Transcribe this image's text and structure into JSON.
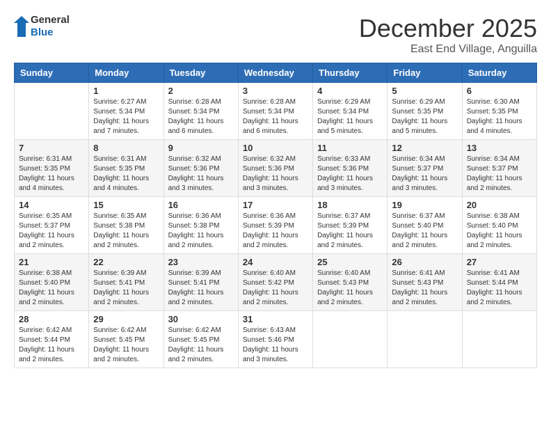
{
  "header": {
    "logo_general": "General",
    "logo_blue": "Blue",
    "month": "December 2025",
    "location": "East End Village, Anguilla"
  },
  "days_of_week": [
    "Sunday",
    "Monday",
    "Tuesday",
    "Wednesday",
    "Thursday",
    "Friday",
    "Saturday"
  ],
  "weeks": [
    [
      {
        "day": "",
        "info": ""
      },
      {
        "day": "1",
        "info": "Sunrise: 6:27 AM\nSunset: 5:34 PM\nDaylight: 11 hours\nand 7 minutes."
      },
      {
        "day": "2",
        "info": "Sunrise: 6:28 AM\nSunset: 5:34 PM\nDaylight: 11 hours\nand 6 minutes."
      },
      {
        "day": "3",
        "info": "Sunrise: 6:28 AM\nSunset: 5:34 PM\nDaylight: 11 hours\nand 6 minutes."
      },
      {
        "day": "4",
        "info": "Sunrise: 6:29 AM\nSunset: 5:34 PM\nDaylight: 11 hours\nand 5 minutes."
      },
      {
        "day": "5",
        "info": "Sunrise: 6:29 AM\nSunset: 5:35 PM\nDaylight: 11 hours\nand 5 minutes."
      },
      {
        "day": "6",
        "info": "Sunrise: 6:30 AM\nSunset: 5:35 PM\nDaylight: 11 hours\nand 4 minutes."
      }
    ],
    [
      {
        "day": "7",
        "info": "Sunrise: 6:31 AM\nSunset: 5:35 PM\nDaylight: 11 hours\nand 4 minutes."
      },
      {
        "day": "8",
        "info": "Sunrise: 6:31 AM\nSunset: 5:35 PM\nDaylight: 11 hours\nand 4 minutes."
      },
      {
        "day": "9",
        "info": "Sunrise: 6:32 AM\nSunset: 5:36 PM\nDaylight: 11 hours\nand 3 minutes."
      },
      {
        "day": "10",
        "info": "Sunrise: 6:32 AM\nSunset: 5:36 PM\nDaylight: 11 hours\nand 3 minutes."
      },
      {
        "day": "11",
        "info": "Sunrise: 6:33 AM\nSunset: 5:36 PM\nDaylight: 11 hours\nand 3 minutes."
      },
      {
        "day": "12",
        "info": "Sunrise: 6:34 AM\nSunset: 5:37 PM\nDaylight: 11 hours\nand 3 minutes."
      },
      {
        "day": "13",
        "info": "Sunrise: 6:34 AM\nSunset: 5:37 PM\nDaylight: 11 hours\nand 2 minutes."
      }
    ],
    [
      {
        "day": "14",
        "info": "Sunrise: 6:35 AM\nSunset: 5:37 PM\nDaylight: 11 hours\nand 2 minutes."
      },
      {
        "day": "15",
        "info": "Sunrise: 6:35 AM\nSunset: 5:38 PM\nDaylight: 11 hours\nand 2 minutes."
      },
      {
        "day": "16",
        "info": "Sunrise: 6:36 AM\nSunset: 5:38 PM\nDaylight: 11 hours\nand 2 minutes."
      },
      {
        "day": "17",
        "info": "Sunrise: 6:36 AM\nSunset: 5:39 PM\nDaylight: 11 hours\nand 2 minutes."
      },
      {
        "day": "18",
        "info": "Sunrise: 6:37 AM\nSunset: 5:39 PM\nDaylight: 11 hours\nand 2 minutes."
      },
      {
        "day": "19",
        "info": "Sunrise: 6:37 AM\nSunset: 5:40 PM\nDaylight: 11 hours\nand 2 minutes."
      },
      {
        "day": "20",
        "info": "Sunrise: 6:38 AM\nSunset: 5:40 PM\nDaylight: 11 hours\nand 2 minutes."
      }
    ],
    [
      {
        "day": "21",
        "info": "Sunrise: 6:38 AM\nSunset: 5:40 PM\nDaylight: 11 hours\nand 2 minutes."
      },
      {
        "day": "22",
        "info": "Sunrise: 6:39 AM\nSunset: 5:41 PM\nDaylight: 11 hours\nand 2 minutes."
      },
      {
        "day": "23",
        "info": "Sunrise: 6:39 AM\nSunset: 5:41 PM\nDaylight: 11 hours\nand 2 minutes."
      },
      {
        "day": "24",
        "info": "Sunrise: 6:40 AM\nSunset: 5:42 PM\nDaylight: 11 hours\nand 2 minutes."
      },
      {
        "day": "25",
        "info": "Sunrise: 6:40 AM\nSunset: 5:43 PM\nDaylight: 11 hours\nand 2 minutes."
      },
      {
        "day": "26",
        "info": "Sunrise: 6:41 AM\nSunset: 5:43 PM\nDaylight: 11 hours\nand 2 minutes."
      },
      {
        "day": "27",
        "info": "Sunrise: 6:41 AM\nSunset: 5:44 PM\nDaylight: 11 hours\nand 2 minutes."
      }
    ],
    [
      {
        "day": "28",
        "info": "Sunrise: 6:42 AM\nSunset: 5:44 PM\nDaylight: 11 hours\nand 2 minutes."
      },
      {
        "day": "29",
        "info": "Sunrise: 6:42 AM\nSunset: 5:45 PM\nDaylight: 11 hours\nand 2 minutes."
      },
      {
        "day": "30",
        "info": "Sunrise: 6:42 AM\nSunset: 5:45 PM\nDaylight: 11 hours\nand 2 minutes."
      },
      {
        "day": "31",
        "info": "Sunrise: 6:43 AM\nSunset: 5:46 PM\nDaylight: 11 hours\nand 3 minutes."
      },
      {
        "day": "",
        "info": ""
      },
      {
        "day": "",
        "info": ""
      },
      {
        "day": "",
        "info": ""
      }
    ]
  ]
}
